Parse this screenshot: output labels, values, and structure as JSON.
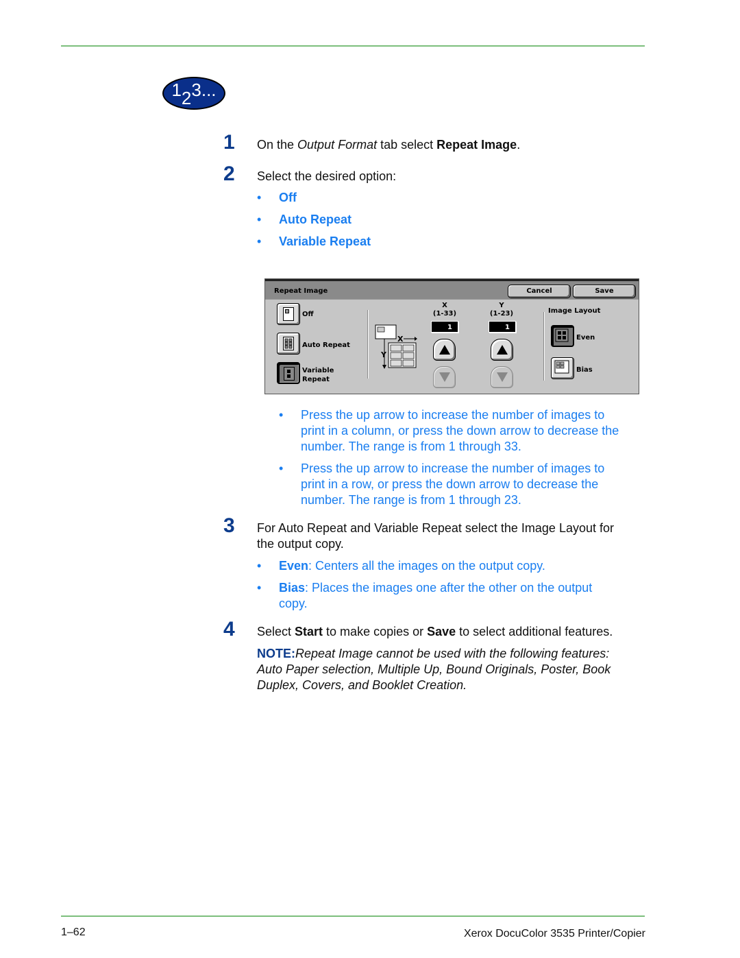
{
  "badge": {
    "parts": [
      "1",
      "2",
      "3..."
    ]
  },
  "steps": [
    {
      "number": "1",
      "pre": "On the ",
      "italic": "Output Format",
      "mid": " tab select ",
      "bold": "Repeat Image",
      "post": "."
    },
    {
      "number": "2",
      "text": "Select the desired option:",
      "options": [
        "Off",
        "Auto Repeat",
        "Variable Repeat"
      ]
    },
    {
      "number": "3",
      "text_line1": "For Auto Repeat and Variable Repeat select the Image Layout for",
      "text_line2": "the output copy.",
      "bullets": [
        {
          "term": "Even",
          "desc": ": Centers all the images on the output copy."
        },
        {
          "term": "Bias",
          "desc_line1": ": Places the images one after the other on the output",
          "desc_line2": "copy."
        }
      ]
    },
    {
      "number": "4",
      "pre": "Select ",
      "bold1": "Start",
      "mid": " to make copies or ",
      "bold2": "Save",
      "post": " to select additional features."
    }
  ],
  "arrow_notes": [
    {
      "lines": [
        "Press the up arrow to increase the number of images to",
        "print in a column, or press the down arrow to decrease the",
        "number.  The range is from 1 through 33."
      ]
    },
    {
      "lines": [
        "Press the up arrow to increase the number of images to",
        "print in a row, or press the down arrow to decrease the",
        "number.  The range is from 1 through 23."
      ]
    }
  ],
  "note": {
    "label": "NOTE:",
    "lines": [
      "Repeat Image cannot be used with the following features:",
      "Auto Paper selection, Multiple Up, Bound Originals, Poster, Book",
      "Duplex, Covers, and Booklet Creation."
    ]
  },
  "panel": {
    "title": "Repeat Image",
    "cancel_label": "Cancel",
    "save_label": "Save",
    "options": [
      {
        "label_line1": "Off",
        "label_line2": "",
        "selected": false
      },
      {
        "label_line1": "Auto Repeat",
        "label_line2": "",
        "selected": false
      },
      {
        "label_line1": "Variable",
        "label_line2": "Repeat",
        "selected": true
      }
    ],
    "x": {
      "label": "X",
      "range": "(1-33)",
      "value": "1"
    },
    "y": {
      "label": "Y",
      "range": "(1-23)",
      "value": "1"
    },
    "diagram": {
      "x_label": "X",
      "y_label": "Y"
    },
    "layout": {
      "title": "Image Layout",
      "even_label": "Even",
      "bias_label": "Bias",
      "selected": "Even"
    }
  },
  "footer": {
    "page": "1–62",
    "product": "Xerox DocuColor 3535 Printer/Copier"
  },
  "colors": {
    "accent_blue": "#1a7ef0",
    "step_number": "#0d3c8c",
    "rule_green": "#7cbf7c",
    "badge_bg": "#0a2f8a"
  }
}
